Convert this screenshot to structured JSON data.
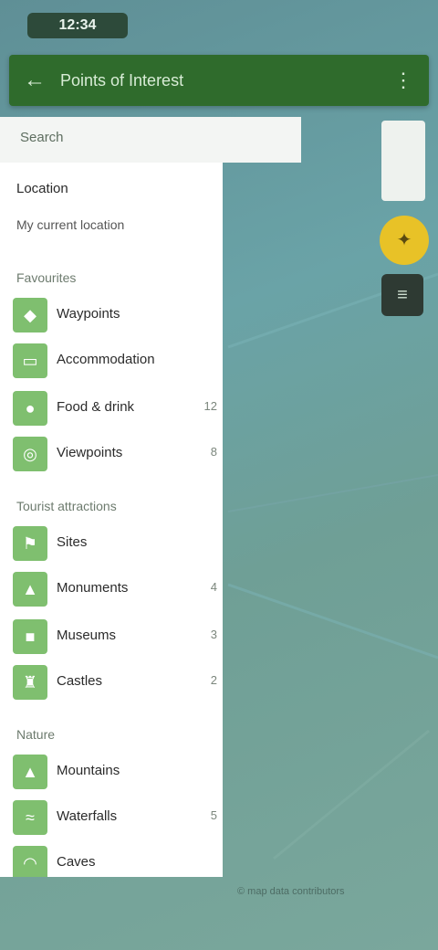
{
  "status": {
    "time": "12:34"
  },
  "header": {
    "title": "Points of Interest",
    "back_icon": "arrow-left-icon",
    "menu_icon": "more-vert-icon"
  },
  "search": {
    "label": "Search"
  },
  "drawer": {
    "location_title": "Location",
    "location_sub": "My current location",
    "sections": [
      {
        "title": "Favourites",
        "items": [
          {
            "label": "Waypoints",
            "count": ""
          },
          {
            "label": "Accommodation",
            "count": ""
          },
          {
            "label": "Food & drink",
            "count": "12"
          },
          {
            "label": "Viewpoints",
            "count": "8"
          }
        ]
      },
      {
        "title": "Tourist attractions",
        "items": [
          {
            "label": "Sites",
            "count": ""
          },
          {
            "label": "Monuments",
            "count": "4"
          },
          {
            "label": "Museums",
            "count": "3"
          },
          {
            "label": "Castles",
            "count": "2"
          }
        ]
      },
      {
        "title": "Nature",
        "items": [
          {
            "label": "Mountains",
            "count": ""
          },
          {
            "label": "Waterfalls",
            "count": "5"
          },
          {
            "label": "Caves",
            "count": ""
          }
        ]
      }
    ]
  },
  "map": {
    "footer": "© map data contributors"
  },
  "colors": {
    "header": "#2f6b2c",
    "icon_bg": "#7fbf6f",
    "compass": "#e8c227"
  }
}
